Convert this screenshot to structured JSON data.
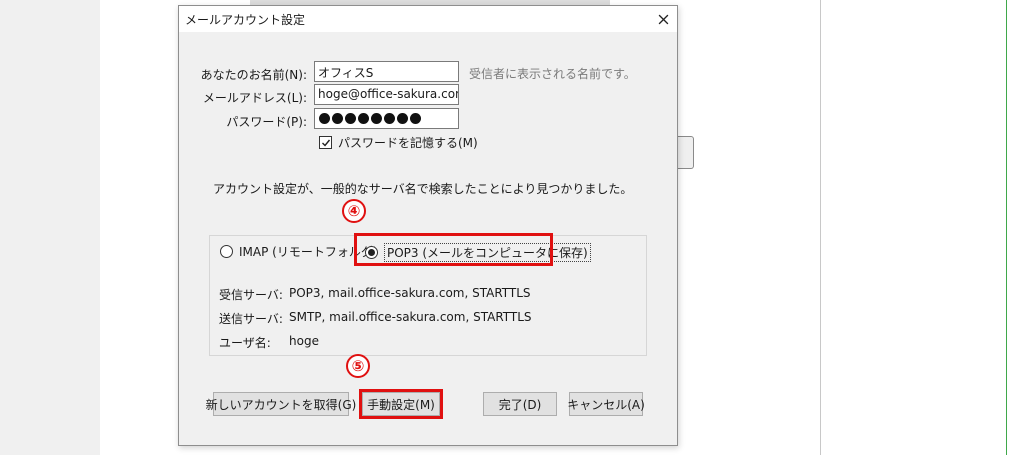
{
  "dialog": {
    "title": "メールアカウント設定"
  },
  "form": {
    "name_label": "あなたのお名前(N):",
    "name_value": "オフィスS",
    "name_hint": "受信者に表示される名前です。",
    "email_label": "メールアドレス(L):",
    "email_value": "hoge@office-sakura.com",
    "password_label": "パスワード(P):",
    "password_mask_count": 8,
    "remember_label": "パスワードを記憶する(M)",
    "remember_checked": true
  },
  "found_message": "アカウント設定が、一般的なサーバ名で検索したことにより見つかりました。",
  "markers": {
    "step4": "④",
    "step5": "⑤"
  },
  "protocol": {
    "imap_label": "IMAP (リモートフォルダ)",
    "pop3_label": "POP3 (メールをコンピュータに保存)",
    "selected": "POP3"
  },
  "server_info": {
    "incoming_label": "受信サーバ:",
    "incoming_value": "POP3, mail.office-sakura.com, STARTTLS",
    "outgoing_label": "送信サーバ:",
    "outgoing_value": "SMTP, mail.office-sakura.com, STARTTLS",
    "user_label": "ユーザ名:",
    "user_value": "hoge"
  },
  "buttons": {
    "new_account": "新しいアカウントを取得(G)",
    "manual": "手動設定(M)",
    "done": "完了(D)",
    "cancel": "キャンセル(A)"
  },
  "colors": {
    "highlight": "#e01010",
    "dialog_bg": "#f0f0f0"
  }
}
